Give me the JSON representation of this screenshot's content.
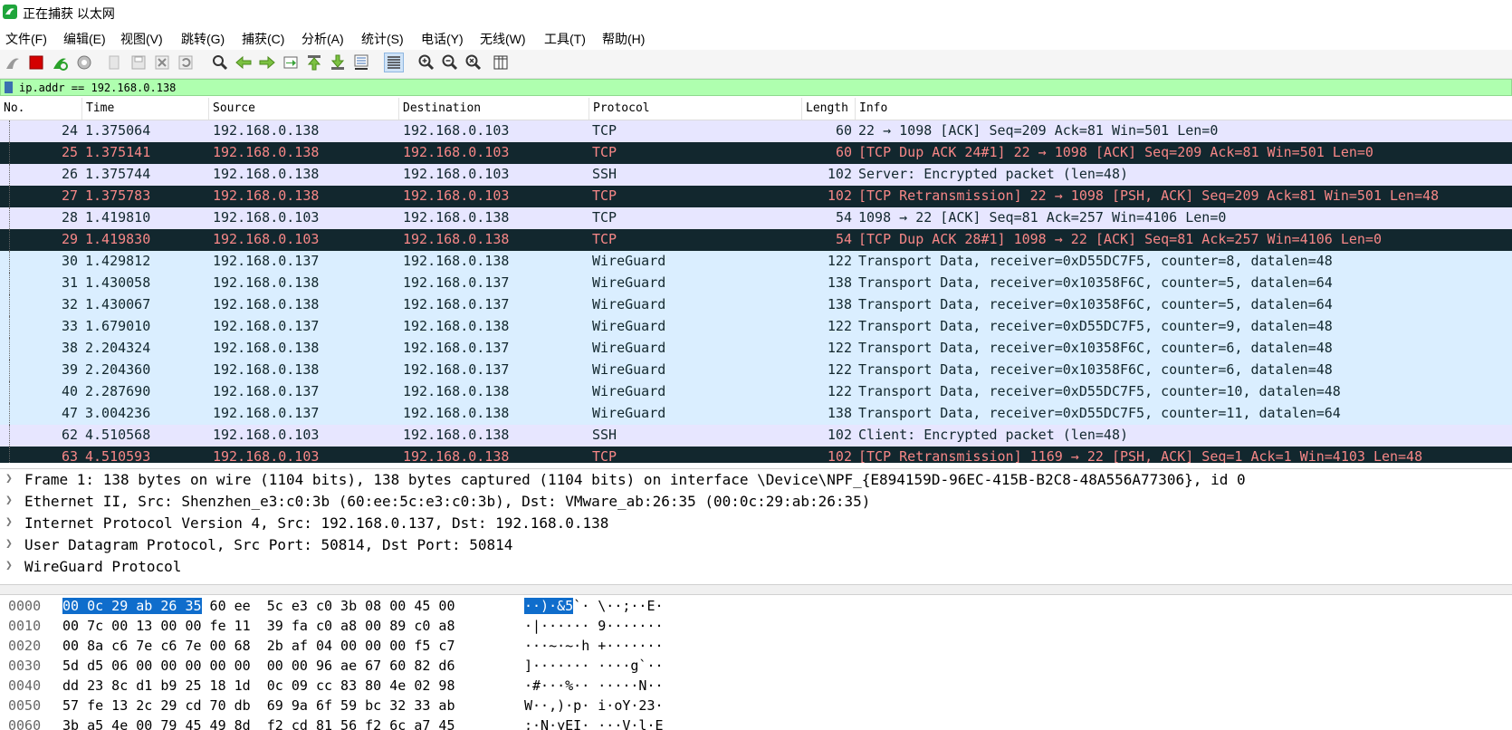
{
  "window": {
    "title": "正在捕获 以太网"
  },
  "menu": [
    "文件(F)",
    "编辑(E)",
    "视图(V)",
    "跳转(G)",
    "捕获(C)",
    "分析(A)",
    "统计(S)",
    "电话(Y)",
    "无线(W)",
    "工具(T)",
    "帮助(H)"
  ],
  "toolbar": {
    "icons": [
      "shark-fin-start-icon",
      "stop-capture-icon",
      "restart-capture-icon",
      "capture-options-icon",
      "open-file-icon",
      "save-file-icon",
      "close-file-icon",
      "reload-file-icon",
      "find-packet-icon",
      "go-back-icon",
      "go-forward-icon",
      "go-to-packet-icon",
      "first-packet-icon",
      "last-packet-icon",
      "auto-scroll-icon",
      "colorize-icon",
      "zoom-in-icon",
      "zoom-out-icon",
      "normal-size-icon",
      "resize-columns-icon"
    ]
  },
  "filter": {
    "value": "ip.addr == 192.168.0.138"
  },
  "packet_list": {
    "columns": [
      "No.",
      "Time",
      "Source",
      "Destination",
      "Protocol",
      "Length",
      "Info"
    ],
    "rows": [
      {
        "no": "24",
        "time": "1.375064",
        "src": "192.168.0.138",
        "dst": "192.168.0.103",
        "proto": "TCP",
        "len": "60",
        "info": "22 → 1098 [ACK] Seq=209 Ack=81 Win=501 Len=0",
        "bg": "#e7e6ff",
        "fg": "#12272e"
      },
      {
        "no": "25",
        "time": "1.375141",
        "src": "192.168.0.138",
        "dst": "192.168.0.103",
        "proto": "TCP",
        "len": "60",
        "info": "[TCP Dup ACK 24#1] 22 → 1098 [ACK] Seq=209 Ack=81 Win=501 Len=0",
        "bg": "#12272e",
        "fg": "#f78787"
      },
      {
        "no": "26",
        "time": "1.375744",
        "src": "192.168.0.138",
        "dst": "192.168.0.103",
        "proto": "SSH",
        "len": "102",
        "info": "Server: Encrypted packet (len=48)",
        "bg": "#e7e6ff",
        "fg": "#12272e"
      },
      {
        "no": "27",
        "time": "1.375783",
        "src": "192.168.0.138",
        "dst": "192.168.0.103",
        "proto": "TCP",
        "len": "102",
        "info": "[TCP Retransmission] 22 → 1098 [PSH, ACK] Seq=209 Ack=81 Win=501 Len=48",
        "bg": "#12272e",
        "fg": "#f78787"
      },
      {
        "no": "28",
        "time": "1.419810",
        "src": "192.168.0.103",
        "dst": "192.168.0.138",
        "proto": "TCP",
        "len": "54",
        "info": "1098 → 22 [ACK] Seq=81 Ack=257 Win=4106 Len=0",
        "bg": "#e7e6ff",
        "fg": "#12272e"
      },
      {
        "no": "29",
        "time": "1.419830",
        "src": "192.168.0.103",
        "dst": "192.168.0.138",
        "proto": "TCP",
        "len": "54",
        "info": "[TCP Dup ACK 28#1] 1098 → 22 [ACK] Seq=81 Ack=257 Win=4106 Len=0",
        "bg": "#12272e",
        "fg": "#f78787"
      },
      {
        "no": "30",
        "time": "1.429812",
        "src": "192.168.0.137",
        "dst": "192.168.0.138",
        "proto": "WireGuard",
        "len": "122",
        "info": "Transport Data, receiver=0xD55DC7F5, counter=8, datalen=48",
        "bg": "#daeeff",
        "fg": "#12272e"
      },
      {
        "no": "31",
        "time": "1.430058",
        "src": "192.168.0.138",
        "dst": "192.168.0.137",
        "proto": "WireGuard",
        "len": "138",
        "info": "Transport Data, receiver=0x10358F6C, counter=5, datalen=64",
        "bg": "#daeeff",
        "fg": "#12272e"
      },
      {
        "no": "32",
        "time": "1.430067",
        "src": "192.168.0.138",
        "dst": "192.168.0.137",
        "proto": "WireGuard",
        "len": "138",
        "info": "Transport Data, receiver=0x10358F6C, counter=5, datalen=64",
        "bg": "#daeeff",
        "fg": "#12272e"
      },
      {
        "no": "33",
        "time": "1.679010",
        "src": "192.168.0.137",
        "dst": "192.168.0.138",
        "proto": "WireGuard",
        "len": "122",
        "info": "Transport Data, receiver=0xD55DC7F5, counter=9, datalen=48",
        "bg": "#daeeff",
        "fg": "#12272e"
      },
      {
        "no": "38",
        "time": "2.204324",
        "src": "192.168.0.138",
        "dst": "192.168.0.137",
        "proto": "WireGuard",
        "len": "122",
        "info": "Transport Data, receiver=0x10358F6C, counter=6, datalen=48",
        "bg": "#daeeff",
        "fg": "#12272e"
      },
      {
        "no": "39",
        "time": "2.204360",
        "src": "192.168.0.138",
        "dst": "192.168.0.137",
        "proto": "WireGuard",
        "len": "122",
        "info": "Transport Data, receiver=0x10358F6C, counter=6, datalen=48",
        "bg": "#daeeff",
        "fg": "#12272e"
      },
      {
        "no": "40",
        "time": "2.287690",
        "src": "192.168.0.137",
        "dst": "192.168.0.138",
        "proto": "WireGuard",
        "len": "122",
        "info": "Transport Data, receiver=0xD55DC7F5, counter=10, datalen=48",
        "bg": "#daeeff",
        "fg": "#12272e"
      },
      {
        "no": "47",
        "time": "3.004236",
        "src": "192.168.0.137",
        "dst": "192.168.0.138",
        "proto": "WireGuard",
        "len": "138",
        "info": "Transport Data, receiver=0xD55DC7F5, counter=11, datalen=64",
        "bg": "#daeeff",
        "fg": "#12272e"
      },
      {
        "no": "62",
        "time": "4.510568",
        "src": "192.168.0.103",
        "dst": "192.168.0.138",
        "proto": "SSH",
        "len": "102",
        "info": "Client: Encrypted packet (len=48)",
        "bg": "#e7e6ff",
        "fg": "#12272e"
      },
      {
        "no": "63",
        "time": "4.510593",
        "src": "192.168.0.103",
        "dst": "192.168.0.138",
        "proto": "TCP",
        "len": "102",
        "info": "[TCP Retransmission] 1169 → 22 [PSH, ACK] Seq=1 Ack=1 Win=4103 Len=48",
        "bg": "#12272e",
        "fg": "#f78787"
      }
    ]
  },
  "details": [
    "Frame 1: 138 bytes on wire (1104 bits), 138 bytes captured (1104 bits) on interface \\Device\\NPF_{E894159D-96EC-415B-B2C8-48A556A77306}, id 0",
    "Ethernet II, Src: Shenzhen_e3:c0:3b (60:ee:5c:e3:c0:3b), Dst: VMware_ab:26:35 (00:0c:29:ab:26:35)",
    "Internet Protocol Version 4, Src: 192.168.0.137, Dst: 192.168.0.138",
    "User Datagram Protocol, Src Port: 50814, Dst Port: 50814",
    "WireGuard Protocol"
  ],
  "bytes": [
    {
      "off": "0000",
      "hex_sel": "00 0c 29 ab 26 35",
      "hex_rest": " 60 ee  5c e3 c0 3b 08 00 45 00",
      "asc_sel": "··)·&5",
      "asc_rest": "`· \\··;··E·"
    },
    {
      "off": "0010",
      "hex_sel": "",
      "hex_rest": "00 7c 00 13 00 00 fe 11  39 fa c0 a8 00 89 c0 a8",
      "asc_sel": "",
      "asc_rest": "·|······ 9·······"
    },
    {
      "off": "0020",
      "hex_sel": "",
      "hex_rest": "00 8a c6 7e c6 7e 00 68  2b af 04 00 00 00 f5 c7",
      "asc_sel": "",
      "asc_rest": "···~·~·h +·······"
    },
    {
      "off": "0030",
      "hex_sel": "",
      "hex_rest": "5d d5 06 00 00 00 00 00  00 00 96 ae 67 60 82 d6",
      "asc_sel": "",
      "asc_rest": "]······· ····g`··"
    },
    {
      "off": "0040",
      "hex_sel": "",
      "hex_rest": "dd 23 8c d1 b9 25 18 1d  0c 09 cc 83 80 4e 02 98",
      "asc_sel": "",
      "asc_rest": "·#···%·· ·····N··"
    },
    {
      "off": "0050",
      "hex_sel": "",
      "hex_rest": "57 fe 13 2c 29 cd 70 db  69 9a 6f 59 bc 32 33 ab",
      "asc_sel": "",
      "asc_rest": "W··,)·p· i·oY·23·"
    },
    {
      "off": "0060",
      "hex_sel": "",
      "hex_rest": "3b a5 4e 00 79 45 49 8d  f2 cd 81 56 f2 6c a7 45",
      "asc_sel": "",
      "asc_rest": ";·N·yEI· ···V·l·E"
    }
  ]
}
